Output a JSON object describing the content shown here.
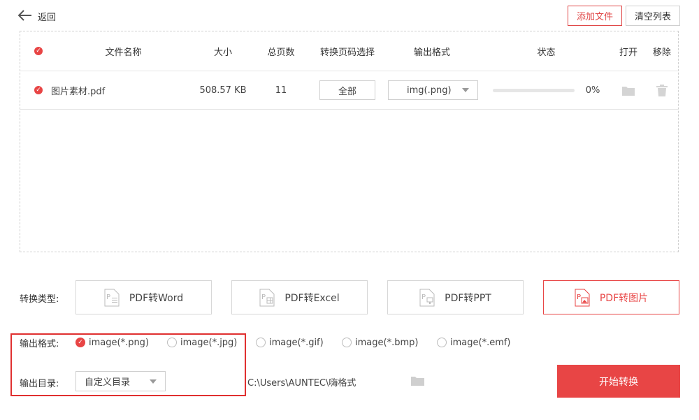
{
  "header": {
    "back_label": "返回",
    "add_file_label": "添加文件",
    "clear_list_label": "清空列表"
  },
  "table": {
    "headers": [
      "文件名称",
      "大小",
      "总页数",
      "转换页码选择",
      "输出格式",
      "状态",
      "打开",
      "移除"
    ],
    "rows": [
      {
        "name": "图片素材.pdf",
        "size": "508.57 KB",
        "pages": "11",
        "page_range": "全部",
        "format": "img(.png)",
        "progress_percent": 0,
        "progress_label": "0%"
      }
    ]
  },
  "conversion": {
    "label": "转换类型:",
    "types": [
      "PDF转Word",
      "PDF转Excel",
      "PDF转PPT",
      "PDF转图片"
    ],
    "active_index": 3
  },
  "output_format": {
    "label": "输出格式:",
    "options": [
      "image(*.png)",
      "image(*.jpg)",
      "image(*.gif)",
      "image(*.bmp)",
      "image(*.emf)"
    ],
    "selected_index": 0
  },
  "output_dir": {
    "label": "输出目录:",
    "mode": "自定义目录",
    "path": "C:\\Users\\AUNTEC\\嗨格式"
  },
  "start_label": "开始转换",
  "colors": {
    "accent": "#e84545"
  }
}
